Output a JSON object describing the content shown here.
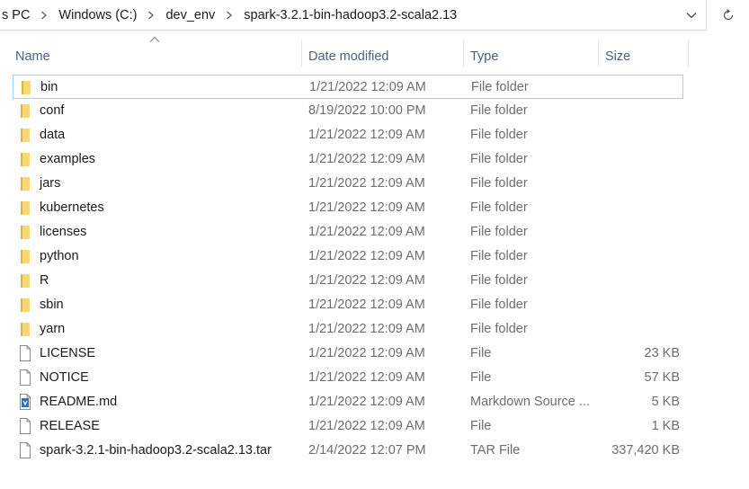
{
  "breadcrumbs": [
    "s PC",
    "Windows (C:)",
    "dev_env",
    "spark-3.2.1-bin-hadoop3.2-scala2.13"
  ],
  "columns": {
    "name": "Name",
    "date": "Date modified",
    "type": "Type",
    "size": "Size"
  },
  "files": [
    {
      "name": "bin",
      "date": "1/21/2022 12:09 AM",
      "type": "File folder",
      "size": "",
      "icon": "folder-icon"
    },
    {
      "name": "conf",
      "date": "8/19/2022 10:00 PM",
      "type": "File folder",
      "size": "",
      "icon": "folder-icon"
    },
    {
      "name": "data",
      "date": "1/21/2022 12:09 AM",
      "type": "File folder",
      "size": "",
      "icon": "folder-icon"
    },
    {
      "name": "examples",
      "date": "1/21/2022 12:09 AM",
      "type": "File folder",
      "size": "",
      "icon": "folder-icon"
    },
    {
      "name": "jars",
      "date": "1/21/2022 12:09 AM",
      "type": "File folder",
      "size": "",
      "icon": "folder-icon"
    },
    {
      "name": "kubernetes",
      "date": "1/21/2022 12:09 AM",
      "type": "File folder",
      "size": "",
      "icon": "folder-icon"
    },
    {
      "name": "licenses",
      "date": "1/21/2022 12:09 AM",
      "type": "File folder",
      "size": "",
      "icon": "folder-icon"
    },
    {
      "name": "python",
      "date": "1/21/2022 12:09 AM",
      "type": "File folder",
      "size": "",
      "icon": "folder-icon"
    },
    {
      "name": "R",
      "date": "1/21/2022 12:09 AM",
      "type": "File folder",
      "size": "",
      "icon": "folder-icon"
    },
    {
      "name": "sbin",
      "date": "1/21/2022 12:09 AM",
      "type": "File folder",
      "size": "",
      "icon": "folder-icon"
    },
    {
      "name": "yarn",
      "date": "1/21/2022 12:09 AM",
      "type": "File folder",
      "size": "",
      "icon": "folder-icon"
    },
    {
      "name": "LICENSE",
      "date": "1/21/2022 12:09 AM",
      "type": "File",
      "size": "23 KB",
      "icon": "file-icon"
    },
    {
      "name": "NOTICE",
      "date": "1/21/2022 12:09 AM",
      "type": "File",
      "size": "57 KB",
      "icon": "file-icon"
    },
    {
      "name": "README.md",
      "date": "1/21/2022 12:09 AM",
      "type": "Markdown Source ...",
      "size": "5 KB",
      "icon": "markdown-file-icon"
    },
    {
      "name": "RELEASE",
      "date": "1/21/2022 12:09 AM",
      "type": "File",
      "size": "1 KB",
      "icon": "file-icon"
    },
    {
      "name": "spark-3.2.1-bin-hadoop3.2-scala2.13.tar",
      "date": "2/14/2022 12:07 PM",
      "type": "TAR File",
      "size": "337,420 KB",
      "icon": "file-icon"
    }
  ],
  "colors": {
    "folder": "#f8d775",
    "folder_dark": "#e0b53d",
    "selection_border": "#99d1ff",
    "header_text": "#4c607a",
    "secondary_text": "#6d6d6d"
  }
}
